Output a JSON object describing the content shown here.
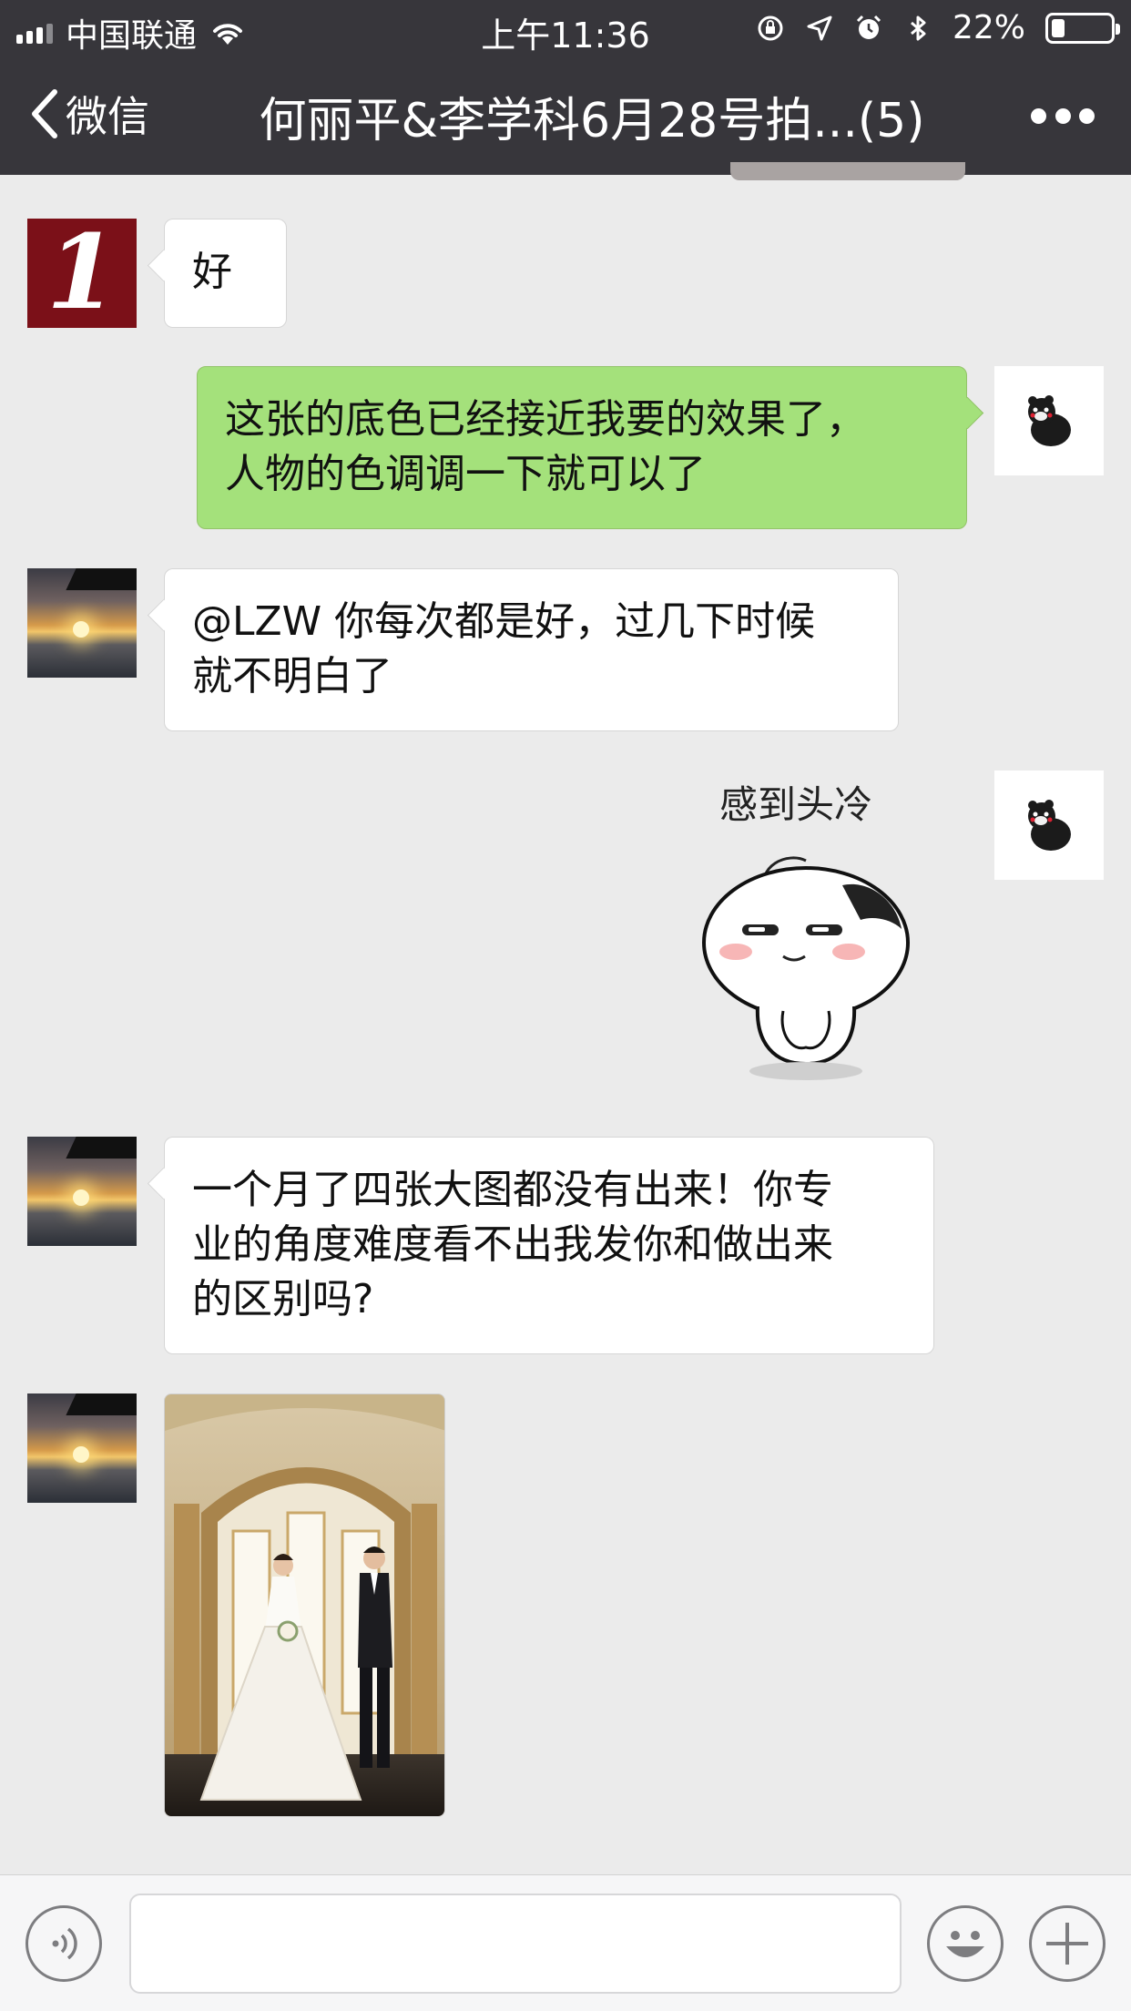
{
  "status_bar": {
    "carrier": "中国联通",
    "time": "上午11:36",
    "battery": "22%",
    "battery_level": 0.22,
    "icons": [
      "signal-icon",
      "wifi-icon",
      "orientation-lock-icon",
      "location-icon",
      "alarm-icon",
      "bluetooth-icon",
      "battery-icon"
    ]
  },
  "nav": {
    "back_label": "微信",
    "title": "何丽平&李学科6月28号拍...(5)",
    "more_icon": "more-icon"
  },
  "messages": [
    {
      "sender": "avatar-logo",
      "direction": "in",
      "type": "text",
      "text": "好"
    },
    {
      "sender": "self",
      "direction": "out",
      "type": "text",
      "lines": [
        "这张的底色已经接近我要的效果了，",
        "人物的色调调一下就可以了"
      ]
    },
    {
      "sender": "sunset",
      "direction": "in",
      "type": "text",
      "lines": [
        "@LZW 你每次都是好，过几下时候",
        "就不明白了"
      ]
    },
    {
      "sender": "self",
      "direction": "out",
      "type": "sticker",
      "caption": "感到头冷"
    },
    {
      "sender": "sunset",
      "direction": "in",
      "type": "text",
      "lines": [
        "一个月了四张大图都没有出来！你专",
        "业的角度难度看不出我发你和做出来",
        "的区别吗?"
      ]
    },
    {
      "sender": "sunset",
      "direction": "in",
      "type": "image",
      "image": "wedding-photo"
    }
  ],
  "avatars": {
    "logo_text": "1"
  },
  "input_bar": {
    "voice_icon": "voice-icon",
    "emoji_icon": "emoji-icon",
    "plus_icon": "plus-icon",
    "placeholder": ""
  },
  "colors": {
    "nav_bg": "#37363b",
    "chat_bg": "#ebebeb",
    "out_bubble": "#a4e17b",
    "in_bubble": "#ffffff"
  }
}
